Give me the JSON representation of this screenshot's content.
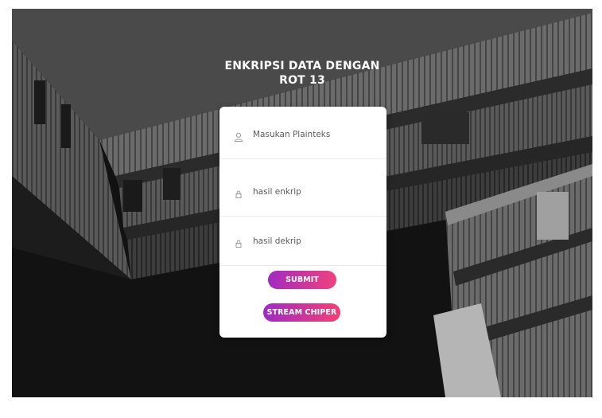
{
  "page": {
    "title_line1": "ENKRIPSI DATA DENGAN",
    "title_line2": "ROT 13"
  },
  "form": {
    "plaintext": {
      "placeholder": "Masukan Plainteks",
      "value": "",
      "icon": "user-icon"
    },
    "encrypted": {
      "placeholder": "hasil enkrip",
      "value": "",
      "icon": "lock-icon"
    },
    "decrypted": {
      "placeholder": "hasil dekrip",
      "value": "",
      "icon": "lock-icon"
    },
    "submit_label": "SUBMIT",
    "stream_label": "STREAM CHIPER"
  },
  "colors": {
    "button_gradient_start": "#a12bc0",
    "button_gradient_end": "#f0417e",
    "card_background": "#ffffff",
    "backdrop": "#141414"
  }
}
